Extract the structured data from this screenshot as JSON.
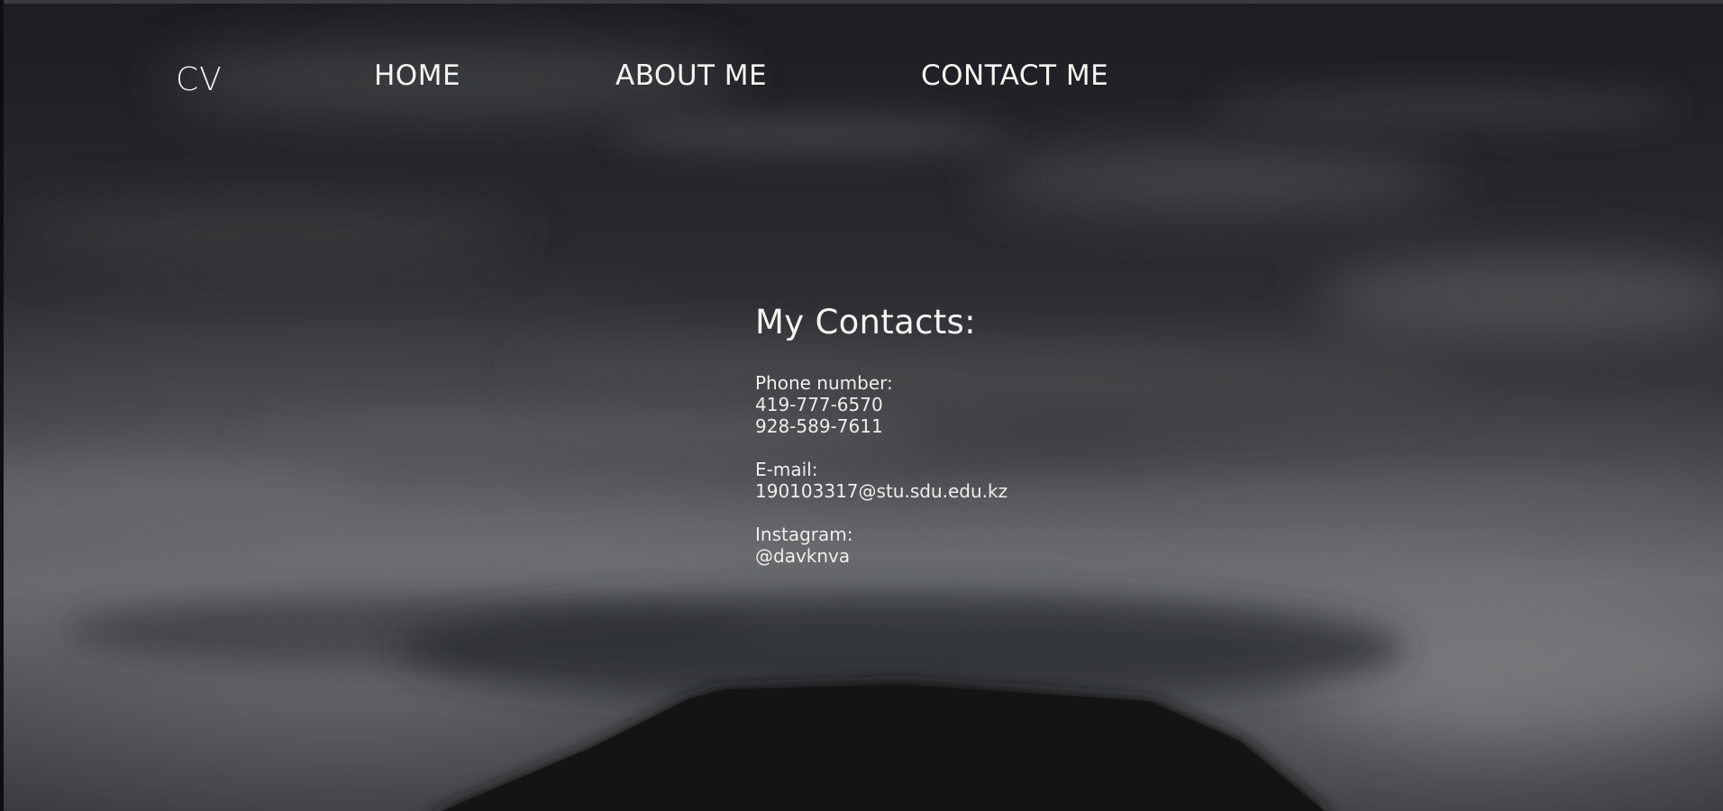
{
  "nav": {
    "logo": "CV",
    "links": [
      {
        "label": "HOME"
      },
      {
        "label": "ABOUT ME"
      },
      {
        "label": "CONTACT ME"
      }
    ]
  },
  "contacts": {
    "title": "My Contacts:",
    "phone": {
      "label": "Phone number:",
      "values": [
        "419-777-6570",
        "928-589-7611"
      ]
    },
    "email": {
      "label": "E-mail:",
      "value": "190103317@stu.sdu.edu.kz"
    },
    "instagram": {
      "label": "Instagram:",
      "value": "@davknva"
    }
  },
  "colors": {
    "text": "#f2f2f2",
    "background": "#1f2124",
    "mountain": "#141517"
  },
  "background_image": "dark cloudy sky over mountain silhouette"
}
